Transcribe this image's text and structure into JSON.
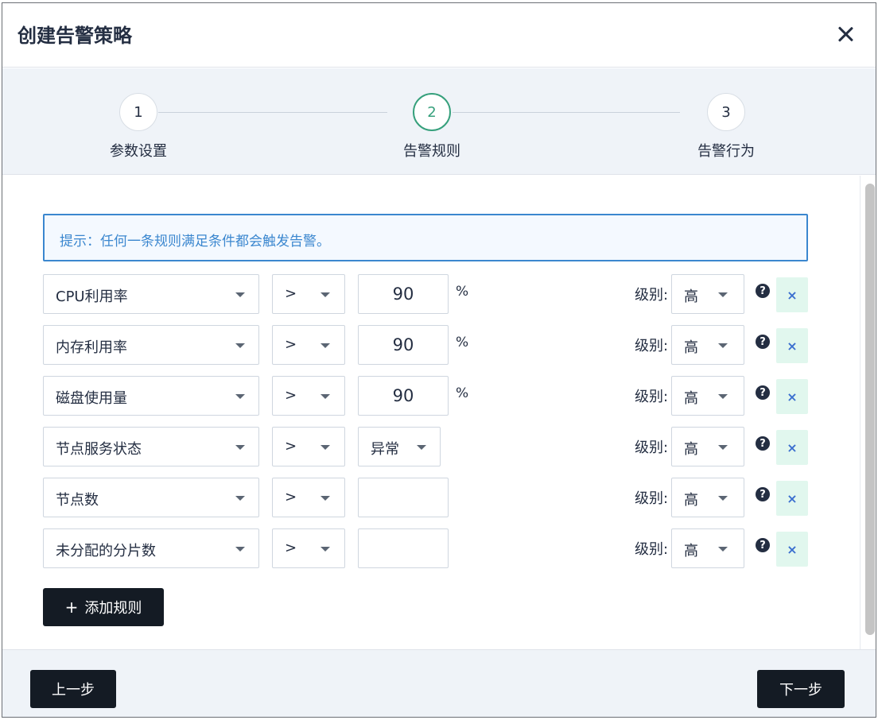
{
  "dialog": {
    "title": "创建告警策略",
    "close_icon": "close-icon"
  },
  "steps": [
    {
      "number": "1",
      "label": "参数设置",
      "state": "done"
    },
    {
      "number": "2",
      "label": "告警规则",
      "state": "active"
    },
    {
      "number": "3",
      "label": "告警行为",
      "state": "pending"
    }
  ],
  "colors": {
    "accent": "#36a07c",
    "tip": "#3b87cf",
    "primary_button": "#141b24",
    "delete_bg": "#e1f7ee"
  },
  "tip": {
    "text": "提示：任何一条规则满足条件都会触发告警。"
  },
  "rules": [
    {
      "metric": "CPU利用率",
      "operator": ">",
      "value": "90",
      "unit": "%",
      "level_label": "级别:",
      "level": "高"
    },
    {
      "metric": "内存利用率",
      "operator": ">",
      "value": "90",
      "unit": "%",
      "level_label": "级别:",
      "level": "高"
    },
    {
      "metric": "磁盘使用量",
      "operator": ">",
      "value": "90",
      "unit": "%",
      "level_label": "级别:",
      "level": "高"
    },
    {
      "metric": "节点服务状态",
      "operator": ">",
      "status": "异常",
      "level_label": "级别:",
      "level": "高"
    },
    {
      "metric": "节点数",
      "operator": ">",
      "value": "",
      "level_label": "级别:",
      "level": "高"
    },
    {
      "metric": "未分配的分片数",
      "operator": ">",
      "value": "",
      "level_label": "级别:",
      "level": "高"
    }
  ],
  "rule_icons": {
    "help": "?",
    "delete": "×"
  },
  "add_rule": {
    "plus": "+",
    "label": "添加规则"
  },
  "footer": {
    "prev_label": "上一步",
    "next_label": "下一步"
  }
}
